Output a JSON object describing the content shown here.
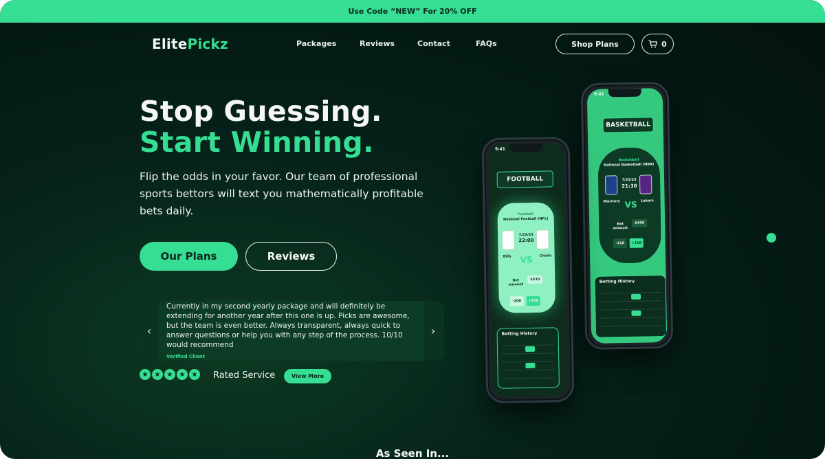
{
  "promo": {
    "text": "Use Code “NEW” For 20% OFF"
  },
  "brand": {
    "part1": "Elite",
    "part2": "Pickz"
  },
  "nav": {
    "items": [
      "Packages",
      "Reviews",
      "Contact",
      "FAQs"
    ],
    "shop_label": "Shop Plans",
    "cart_count": "0"
  },
  "hero": {
    "title_line1": "Stop Guessing.",
    "title_line2": "Start Winning.",
    "subtitle": "Flip the odds in your favor. Our team of professional sports bettors will text you mathematically profitable bets daily.",
    "primary_cta": "Our Plans",
    "secondary_cta": "Reviews"
  },
  "review": {
    "text": "Currently in my second yearly package and will definitely be extending for another year after this one is up. Picks are awesome, but the team is even better. Always transparent, always quick to answer questions or help you with any step of the process. 10/10 would recommend",
    "author": "Verified Client",
    "prev_icon": "‹",
    "next_icon": "›"
  },
  "rating": {
    "stars": 5,
    "label": "Rated Service",
    "cta": "View More"
  },
  "phone_front": {
    "time": "9:41",
    "sport": "FOOTBALL",
    "league_small": "Football",
    "league": "National Football (NFL)",
    "date": "7/23/23",
    "game_time": "22:00",
    "home": "Bills",
    "away": "Chiefs",
    "vs": "VS",
    "bet_label": "Bet amount",
    "bet_value": "$530",
    "odds_left": "-200",
    "odds_right": "+170",
    "history_title": "Betting History"
  },
  "phone_back": {
    "time": "9:41",
    "sport": "BASKETBALL",
    "league_small": "Basketball",
    "league": "National Basketball (NBA)",
    "date": "7/23/23",
    "game_time": "21:30",
    "home": "Warriors",
    "away": "Lakers",
    "vs": "VS",
    "bet_label": "Bet amount",
    "bet_value": "$450",
    "odds_left": "-110",
    "odds_right": "+110",
    "history_title": "Betting History"
  },
  "footer": {
    "as_seen_in": "As Seen In..."
  },
  "colors": {
    "accent": "#35de92",
    "background": "#041712"
  }
}
